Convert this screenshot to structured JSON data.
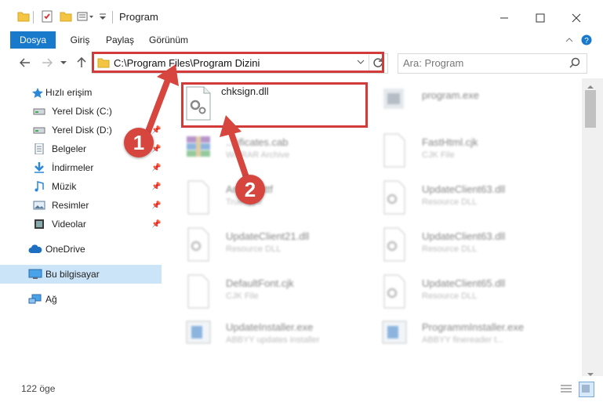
{
  "window": {
    "title": "Program"
  },
  "ribbon": {
    "tabs": [
      "Dosya",
      "Giriş",
      "Paylaş",
      "Görünüm"
    ]
  },
  "address": {
    "path": "C:\\Program Files\\Program Dizini"
  },
  "search": {
    "placeholder": "Ara: Program"
  },
  "sidebar": {
    "items": [
      {
        "label": "Hızlı erişim",
        "icon": "star-icon"
      },
      {
        "label": "Yerel Disk (C:)",
        "icon": "drive-icon"
      },
      {
        "label": "Yerel Disk (D:)",
        "icon": "drive-icon"
      },
      {
        "label": "Belgeler",
        "icon": "documents-icon"
      },
      {
        "label": "İndirmeler",
        "icon": "download-icon"
      },
      {
        "label": "Müzik",
        "icon": "music-icon"
      },
      {
        "label": "Resimler",
        "icon": "pictures-icon"
      },
      {
        "label": "Videolar",
        "icon": "video-icon"
      },
      {
        "label": "OneDrive",
        "icon": "cloud-icon"
      },
      {
        "label": "Bu bilgisayar",
        "icon": "computer-icon"
      },
      {
        "label": "Ağ",
        "icon": "network-icon"
      }
    ]
  },
  "files": [
    {
      "name": "chksign.dll",
      "type": ""
    },
    {
      "name": "program.exe",
      "type": ""
    },
    {
      "name": "...tificates.cab",
      "type": "WinRAR Archive"
    },
    {
      "name": "FastHtml.cjk",
      "type": "CJK File"
    },
    {
      "name": "ArialUni.ttf",
      "type": "TrueType"
    },
    {
      "name": "UpdateClient63.dll",
      "type": "Resource DLL"
    },
    {
      "name": "UpdateClient21.dll",
      "type": "Resource DLL"
    },
    {
      "name": "UpdateClient63.dll",
      "type": "Resource DLL"
    },
    {
      "name": "DefaultFont.cjk",
      "type": "CJK File"
    },
    {
      "name": "UpdateClient65.dll",
      "type": "Resource DLL"
    },
    {
      "name": "UpdateInstaller.exe",
      "type": "ABBYY updates installer"
    },
    {
      "name": "ProgrammInstaller.exe",
      "type": "ABBYY finereader t..."
    }
  ],
  "status": {
    "count": "122 öge"
  },
  "annotations": {
    "step1": "1",
    "step2": "2"
  },
  "colors": {
    "accent": "#1979ca",
    "highlight": "#d33a3a"
  }
}
